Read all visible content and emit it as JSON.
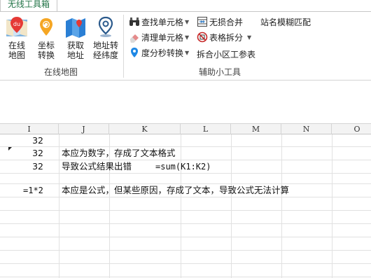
{
  "ribbon": {
    "active_tab": "无线工具箱",
    "groups": {
      "online_map": {
        "label": "在线地图",
        "buttons": [
          {
            "line1": "在线",
            "line2": "地图"
          },
          {
            "line1": "坐标",
            "line2": "转换"
          },
          {
            "line1": "获取",
            "line2": "地址"
          },
          {
            "line1": "地址转",
            "line2": "经纬度"
          }
        ]
      },
      "aux_tools": {
        "label": "辅助小工具",
        "find_cell": "查找单元格",
        "clean_cell": "清理单元格",
        "dms_convert": "度分秒转换",
        "lossless_merge": "无损合并",
        "table_split": "表格拆分",
        "split_district": "拆合小区工参表",
        "fuzzy_match": "站名模糊匹配"
      }
    }
  },
  "sheet": {
    "columns": [
      "I",
      "J",
      "K",
      "L",
      "M",
      "N",
      "O"
    ],
    "rows": [
      {
        "i": "32",
        "j": ""
      },
      {
        "i": "32",
        "j": "本应为数字，存成了文本格式"
      },
      {
        "i": "32",
        "j": "导致公式结果出错",
        "formula": "=sum(K1:K2)"
      },
      {
        "i": "",
        "j": ""
      },
      {
        "i": "=1*2",
        "j": "本应是公式，但某些原因，存成了文本，导致公式无法计算"
      }
    ]
  },
  "colors": {
    "accent_green": "#217346",
    "grid_line": "#e1e1e1",
    "header_bg": "#f3f3f3"
  }
}
